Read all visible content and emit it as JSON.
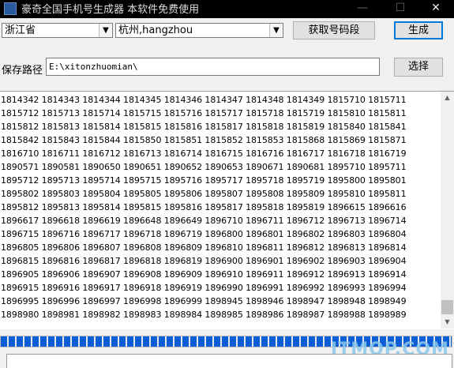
{
  "window": {
    "title": "豪奇全国手机号生成器  本软件免费使用",
    "min_glyph": "—",
    "max_glyph": "☐",
    "close_glyph": "✕"
  },
  "controls": {
    "province": "浙江省",
    "city": "杭州,hangzhou",
    "get_segments_label": "获取号码段",
    "generate_label": "生成",
    "save_path_label": "保存路径",
    "save_path_value": "E:\\xitonzhuomian\\",
    "choose_label": "选择",
    "dropdown_icon": "▼"
  },
  "output": {
    "lines": [
      "1814342 1814343 1814344 1814345 1814346 1814347 1814348 1814349 1815710 1815711",
      "1815712 1815713 1815714 1815715 1815716 1815717 1815718 1815719 1815810 1815811",
      "1815812 1815813 1815814 1815815 1815816 1815817 1815818 1815819 1815840 1815841",
      "1815842 1815843 1815844 1815850 1815851 1815852 1815853 1815868 1815869 1815871",
      "1816710 1816711 1816712 1816713 1816714 1816715 1816716 1816717 1816718 1816719",
      "1890571 1890581 1890650 1890651 1890652 1890653 1890671 1890681 1895710 1895711",
      "1895712 1895713 1895714 1895715 1895716 1895717 1895718 1895719 1895800 1895801",
      "1895802 1895803 1895804 1895805 1895806 1895807 1895808 1895809 1895810 1895811",
      "1895812 1895813 1895814 1895815 1895816 1895817 1895818 1895819 1896615 1896616",
      "1896617 1896618 1896619 1896648 1896649 1896710 1896711 1896712 1896713 1896714",
      "1896715 1896716 1896717 1896718 1896719 1896800 1896801 1896802 1896803 1896804",
      "1896805 1896806 1896807 1896808 1896809 1896810 1896811 1896812 1896813 1896814",
      "1896815 1896816 1896817 1896818 1896819 1896900 1896901 1896902 1896903 1896904",
      "1896905 1896906 1896907 1896908 1896909 1896910 1896911 1896912 1896913 1896914",
      "1896915 1896916 1896917 1896918 1896919 1896990 1896991 1896992 1896993 1896994",
      "1896995 1896996 1896997 1896998 1896999 1898945 1898946 1898947 1898948 1898949",
      "1898980 1898981 1898982 1898983 1898984 1898985 1898986 1898987 1898988 1898989"
    ],
    "scroll_up_glyph": "▲",
    "scroll_down_glyph": "▼"
  },
  "progress": {
    "value": 1.0
  },
  "watermark": "ITMOP.COM"
}
